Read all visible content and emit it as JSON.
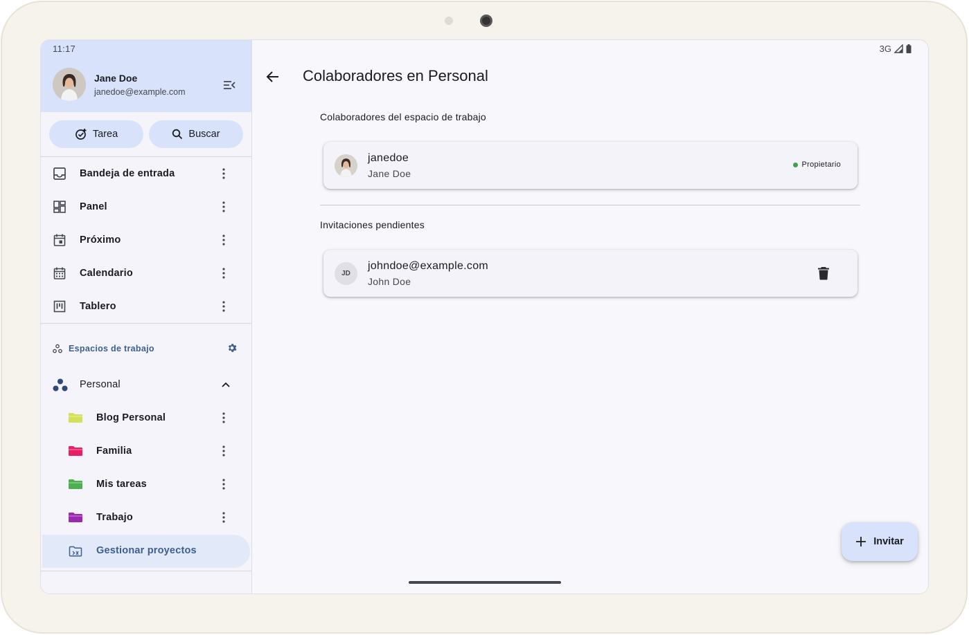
{
  "status_bar": {
    "time": "11:17",
    "network": "3G"
  },
  "user": {
    "name": "Jane Doe",
    "email": "janedoe@example.com"
  },
  "quick_actions": {
    "task_label": "Tarea",
    "search_label": "Buscar"
  },
  "nav": {
    "items": [
      {
        "label": "Bandeja de entrada",
        "icon": "inbox-icon"
      },
      {
        "label": "Panel",
        "icon": "dashboard-icon"
      },
      {
        "label": "Próximo",
        "icon": "calendar-today-icon"
      },
      {
        "label": "Calendario",
        "icon": "calendar-month-icon"
      },
      {
        "label": "Tablero",
        "icon": "board-icon"
      }
    ]
  },
  "workspaces": {
    "header_label": "Espacios de trabajo",
    "current": "Personal",
    "projects": [
      {
        "label": "Blog Personal",
        "color": "#d4e157"
      },
      {
        "label": "Familia",
        "color": "#e91e63"
      },
      {
        "label": "Mis tareas",
        "color": "#4caf50"
      },
      {
        "label": "Trabajo",
        "color": "#9c27b0"
      }
    ],
    "manage_label": "Gestionar proyectos"
  },
  "main": {
    "title": "Colaboradores en Personal",
    "collaborators_title": "Colaboradores del espacio de trabajo",
    "collaborators": [
      {
        "username": "janedoe",
        "name": "Jane Doe",
        "role": "Propietario"
      }
    ],
    "pending_title": "Invitaciones pendientes",
    "pending": [
      {
        "email": "johndoe@example.com",
        "name": "John Doe",
        "initials": "JD"
      }
    ],
    "invite_label": "Invitar"
  },
  "colors": {
    "accent": "#d8e3fb",
    "accent_text": "#3d5f8f",
    "owner_status": "#3fa34d"
  }
}
